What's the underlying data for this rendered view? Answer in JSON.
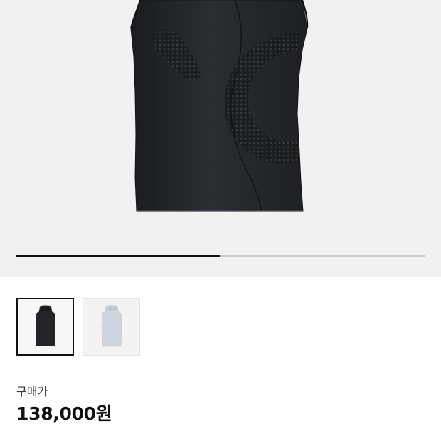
{
  "gallery": {
    "progress_fraction": 0.5,
    "thumbnails": [
      {
        "name": "black-sleeveless-top",
        "selected": true
      },
      {
        "name": "light-blue-sleeveless-top",
        "selected": false
      }
    ]
  },
  "price": {
    "label": "구매가",
    "value": "138,000원"
  },
  "colors": {
    "hero_bg": "#f1f1f1",
    "product_black": "#232528",
    "product_light": "#cfd6de",
    "accent": "#111111"
  }
}
